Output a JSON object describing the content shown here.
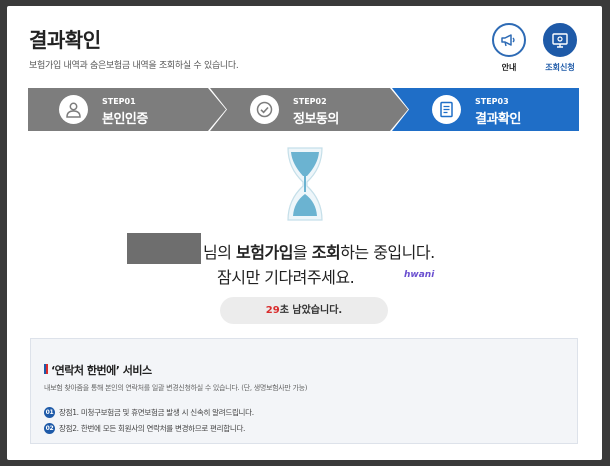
{
  "header": {
    "title": "결과확인",
    "subtitle": "보험가입 내역과 숨은보험금 내역을 조회하실 수 있습니다.",
    "notice_label": "안내",
    "apply_label": "조회신청"
  },
  "steps": [
    {
      "num": "STEP01",
      "label": "본인인증",
      "icon": "person-icon",
      "active": false
    },
    {
      "num": "STEP02",
      "label": "정보동의",
      "icon": "check-circle-icon",
      "active": false
    },
    {
      "num": "STEP03",
      "label": "결과확인",
      "icon": "document-icon",
      "active": true
    }
  ],
  "status": {
    "suffix_name": "님의 ",
    "insurance": "보험가입",
    "particle": "을 ",
    "inquiry": "조회",
    "tail": "하는 중입니다.",
    "wait": "잠시만 기다려주세요.",
    "watermark": "hwani"
  },
  "timer": {
    "seconds": "29",
    "suffix": "초 남았습니다."
  },
  "service": {
    "title": "‘연락처 한번에’ 서비스",
    "description": "내보험 찾아줌을 통해 본인의 연락처를 일괄 변경신청하실 수 있습니다. (단, 생명보험사만 가능)",
    "items": [
      {
        "num": "01",
        "text": "장점1. 미청구보험금 및 휴면보험금 발생 시 신속히 알려드립니다."
      },
      {
        "num": "02",
        "text": "장점2. 한번에 모든 회원사의 연락처를 변경하므로 편리합니다."
      }
    ]
  },
  "colors": {
    "step_inactive": "#7d7d7d",
    "step_active": "#1f6ec7",
    "accent": "#1e5aa8",
    "timer_seconds": "#d92d2d"
  }
}
